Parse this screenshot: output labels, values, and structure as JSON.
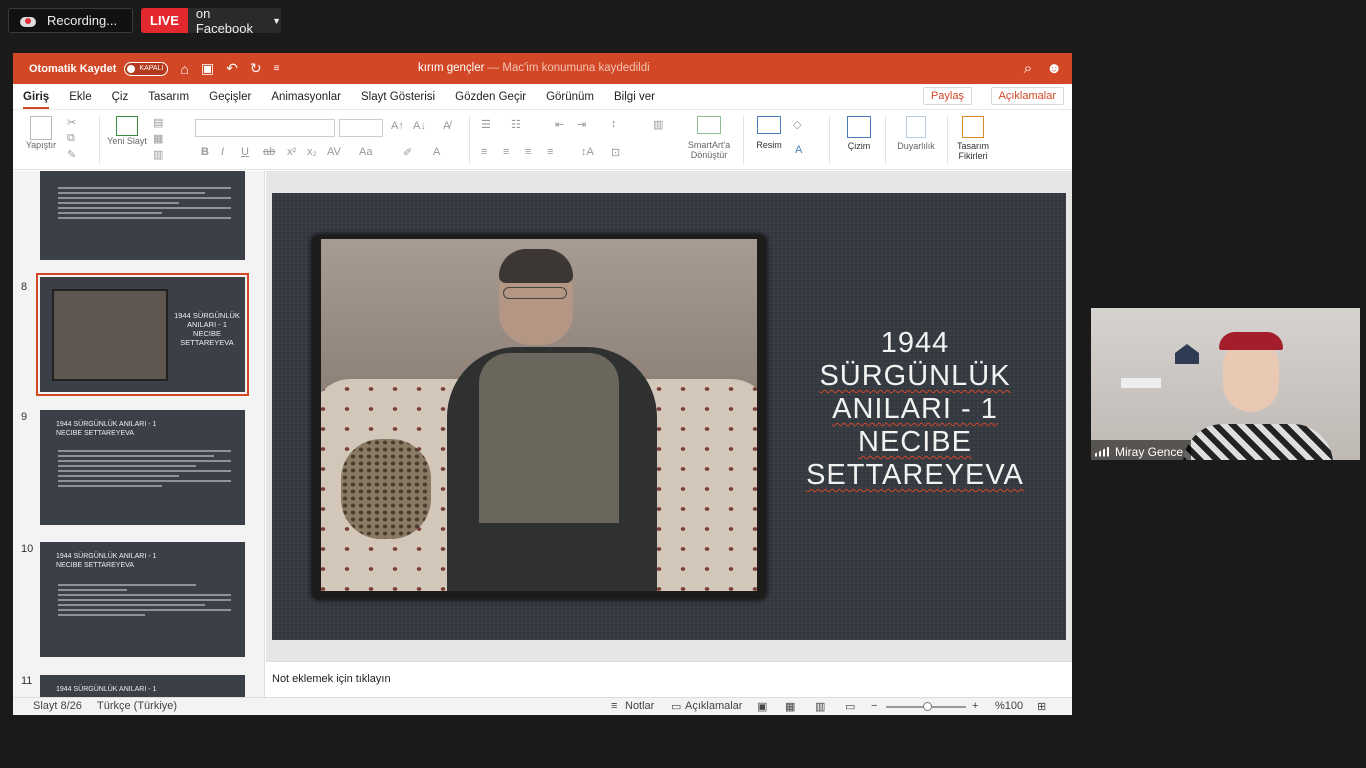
{
  "meeting": {
    "recording_label": "Recording...",
    "live_badge": "LIVE",
    "live_target": "on Facebook",
    "participant_name": "Miray Gence"
  },
  "titlebar": {
    "autosave_label": "Otomatik Kaydet",
    "autosave_state": "KAPALI",
    "doc_name": "kırım gençler",
    "doc_status": "— Mac'im konumuna kaydedildi"
  },
  "menu": {
    "items": [
      "Giriş",
      "Ekle",
      "Çiz",
      "Tasarım",
      "Geçişler",
      "Animasyonlar",
      "Slayt Gösterisi",
      "Gözden Geçir",
      "Görünüm",
      "Bilgi ver"
    ],
    "share": "Paylaş",
    "comments": "Açıklamalar"
  },
  "ribbon": {
    "paste": "Yapıştır",
    "new_slide": "Yeni Slayt",
    "smartart": "SmartArt'a Dönüştür",
    "picture": "Resim",
    "drawing": "Çizim",
    "sensitivity": "Duyarlılık",
    "design_ideas": "Tasarım Fikirleri"
  },
  "slides_panel": {
    "thumbs": [
      {
        "number": "8",
        "title": "1944 SÜRGÜNLÜK ANILARI - 1 NECIBE SETTAREYEVA"
      },
      {
        "number": "9",
        "title": "1944 SÜRGÜNLÜK ANILARI - 1 NECIBE SETTAREYEVA"
      },
      {
        "number": "10",
        "title": "1944 SÜRGÜNLÜK ANILARI - 1 NECIBE SETTAREYEVA"
      },
      {
        "number": "11",
        "title": "1944 SÜRGÜNLÜK ANILARI - 1"
      }
    ]
  },
  "slide": {
    "title_lines": [
      "1944",
      "SÜRGÜNLÜK",
      "ANILARI - 1",
      "NECIBE",
      "SETTAREYEVA"
    ]
  },
  "notes_placeholder": "Not eklemek için tıklayın",
  "status": {
    "slide_counter": "Slayt 8/26",
    "language": "Türkçe (Türkiye)",
    "notes": "Notlar",
    "comments": "Açıklamalar",
    "zoom": "%100"
  },
  "colors": {
    "accent": "#d24726",
    "live_red": "#e3282f"
  }
}
